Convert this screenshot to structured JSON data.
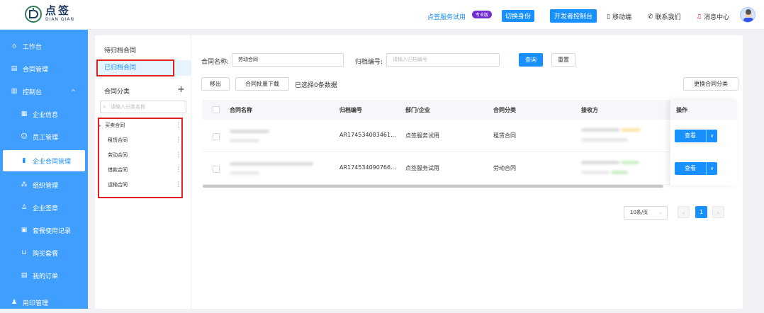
{
  "header": {
    "logo_cn": "点签",
    "logo_en": "DIAN QIAN",
    "trial_text": "点签服务试用",
    "badge": "专业版",
    "switch_label": "切换身份",
    "dev_console": "开发者控制台",
    "mobile": "移动端",
    "contact": "联系我们",
    "messages": "消息中心"
  },
  "sidebar": {
    "items": [
      {
        "label": "工作台",
        "icon": "home-icon"
      },
      {
        "label": "合同管理",
        "icon": "document-icon"
      },
      {
        "label": "控制台",
        "icon": "chart-icon"
      },
      {
        "label": "企业信息",
        "icon": "building-icon"
      },
      {
        "label": "员工管理",
        "icon": "user-icon"
      },
      {
        "label": "企业合同管理",
        "icon": "file-icon"
      },
      {
        "label": "组织管理",
        "icon": "org-icon"
      },
      {
        "label": "企业签章",
        "icon": "stamp-icon"
      },
      {
        "label": "套餐使用记录",
        "icon": "record-icon"
      },
      {
        "label": "购买套餐",
        "icon": "cart-icon"
      },
      {
        "label": "我的订单",
        "icon": "order-icon"
      },
      {
        "label": "用印管理",
        "icon": "seal-icon"
      }
    ]
  },
  "left_panel": {
    "tab_pending": "待归档合同",
    "tab_archived": "已归档合同",
    "category_title": "合同分类",
    "category_search_placeholder": "请输入分类名称",
    "categories": [
      "买卖合同",
      "租赁合同",
      "劳动合同",
      "借款合同",
      "运输合同"
    ]
  },
  "filters": {
    "contract_name_label": "合同名称:",
    "contract_name_value": "劳动合同",
    "archive_no_label": "归档编号:",
    "archive_no_placeholder": "请输入归档编号",
    "search": "查询",
    "reset": "重置"
  },
  "toolbar": {
    "move_out": "移出",
    "batch_download": "合同批量下载",
    "selected_info": "已选择0条数据",
    "change_category": "更换合同分类"
  },
  "table": {
    "headers": [
      "合同名称",
      "归档编号",
      "部门/企业",
      "合同分类",
      "接收方",
      "操作"
    ],
    "rows": [
      {
        "archive_no": "AR174534083461...",
        "dept": "点签服务试用",
        "category": "租赁合同",
        "action": "查看"
      },
      {
        "archive_no": "AR174534090766...",
        "dept": "点签服务试用",
        "category": "劳动合同",
        "action": "查看"
      }
    ]
  },
  "pagination": {
    "page_size": "10条/页",
    "current": "1",
    "prev": "‹",
    "next": "›"
  }
}
